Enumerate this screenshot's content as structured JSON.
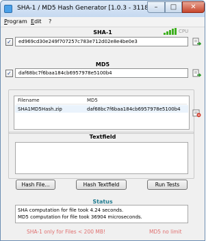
{
  "window": {
    "title": "SHA-1 / MD5 Hash Generator [1.0.3 - 3118]",
    "buttons": {
      "minimize": "–",
      "maximize": "□",
      "close": "✕"
    }
  },
  "menu": [
    {
      "label": "Program",
      "mnemonic": "P"
    },
    {
      "label": "Edit",
      "mnemonic": "E"
    },
    {
      "label": "?",
      "mnemonic": ""
    }
  ],
  "sha1": {
    "title": "SHA-1",
    "enabled": true,
    "value": "ed969cd30e249f707257c783e712d02e8e4be0e3",
    "cpu_label": "CPU",
    "cpu_bars": 5
  },
  "md5": {
    "title": "MD5",
    "enabled": true,
    "value": "daf68bc7f6baa184cb6957978e5100b4"
  },
  "files": {
    "columns": [
      "Filename",
      "MD5"
    ],
    "rows": [
      {
        "filename": "SHA1MD5Hash.zip",
        "md5": "daf68bc7f6baa184cb6957978e5100b4"
      }
    ]
  },
  "textfield": {
    "title": "Textfield",
    "value": ""
  },
  "actions": {
    "hash_file": "Hash File...",
    "hash_textfield": "Hash Textfield",
    "run_tests": "Run Tests"
  },
  "status": {
    "title": "Status",
    "lines": [
      "SHA computation for file took 4.24 seconds.",
      "MD5 computation for file took 36904 microseconds."
    ]
  },
  "footer": {
    "sha1_note": "SHA-1 only for Files < 200 MB!",
    "md5_note": "MD5 no limit"
  },
  "colors": {
    "accent_green": "#3fb020",
    "status_title": "#1f7a8f",
    "footer_note": "#e07070"
  }
}
